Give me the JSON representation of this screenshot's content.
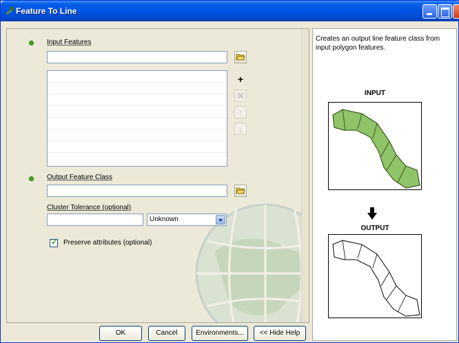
{
  "window": {
    "title": "Feature To Line"
  },
  "form": {
    "input_features_label": "Input Features",
    "input_features_value": "",
    "output_feature_class_label": "Output Feature Class",
    "output_feature_class_value": "",
    "cluster_tolerance_label": "Cluster Tolerance (optional)",
    "cluster_tolerance_value": "",
    "cluster_tolerance_unit": "Unknown",
    "preserve_attributes_label": "Preserve attributes (optional)",
    "preserve_attributes_checked": true
  },
  "buttons": {
    "ok": "OK",
    "cancel": "Cancel",
    "environments": "Environments...",
    "hide_help": "<< Hide Help"
  },
  "help": {
    "description": "Creates an output line feature class from input polygon features.",
    "input_label": "INPUT",
    "output_label": "OUTPUT"
  },
  "icons": {
    "browse": "folder-open-icon",
    "add": "plus-icon",
    "remove": "x-icon",
    "move_up": "arrow-up-icon",
    "move_down": "arrow-down-icon",
    "required": "green-dot-icon"
  },
  "colors": {
    "titlebar": "#0054e3",
    "polygon_fill": "#8fc468",
    "required_dot": "#43a51f"
  }
}
